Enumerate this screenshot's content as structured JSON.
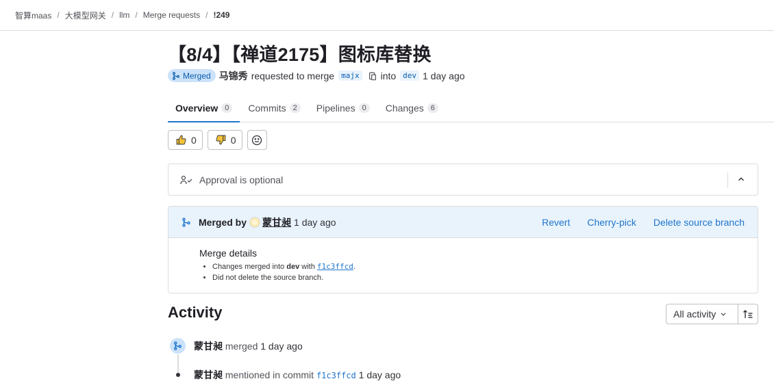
{
  "breadcrumb": {
    "items": [
      "智算maas",
      "大模型网关",
      "llm",
      "Merge requests"
    ],
    "current": "!249"
  },
  "mr": {
    "title": "【8/4】【禅道2175】图标库替换",
    "status": "Merged",
    "author": "马锦秀",
    "requested_text": "requested to merge",
    "source_branch": "majx",
    "into_text": "into",
    "target_branch": "dev",
    "time": "1 day ago"
  },
  "tabs": [
    {
      "label": "Overview",
      "count": "0"
    },
    {
      "label": "Commits",
      "count": "2"
    },
    {
      "label": "Pipelines",
      "count": "0"
    },
    {
      "label": "Changes",
      "count": "6"
    }
  ],
  "reactions": {
    "thumbs_up": "0",
    "thumbs_down": "0"
  },
  "approval": {
    "text": "Approval is optional"
  },
  "merged": {
    "label": "Merged by",
    "user": "蒙甘昶",
    "time": "1 day ago",
    "actions": {
      "revert": "Revert",
      "cherry_pick": "Cherry-pick",
      "delete_branch": "Delete source branch"
    },
    "details_title": "Merge details",
    "detail1_prefix": "Changes merged into",
    "detail1_branch": "dev",
    "detail1_with": "with",
    "detail1_sha": "f1c3ffcd",
    "detail1_end": ".",
    "detail2": "Did not delete the source branch."
  },
  "activity": {
    "title": "Activity",
    "filter_label": "All activity",
    "items": [
      {
        "user": "蒙甘昶",
        "action": "merged",
        "time": "1 day ago"
      },
      {
        "user": "蒙甘昶",
        "action": "mentioned in commit",
        "sha": "f1c3ffcd",
        "time": "1 day ago"
      }
    ]
  },
  "colors": {
    "accent": "#1f75cb",
    "merged_badge_bg": "#cbe2f9",
    "merged_header_bg": "#e9f3fc"
  }
}
